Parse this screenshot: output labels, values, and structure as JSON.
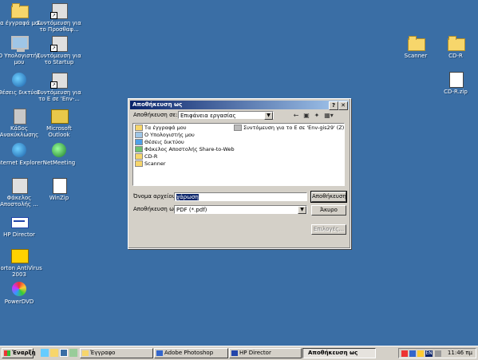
{
  "desktop": {
    "icons": [
      {
        "label": "Τα έγγραφά μου",
        "icon": "my-documents-folder-icon"
      },
      {
        "label": "Συντόμευση για το Προσθαφ...",
        "icon": "shortcut-add-remove-icon"
      },
      {
        "label": "Ο Υπολογιστής μου",
        "icon": "my-computer-icon"
      },
      {
        "label": "Συντόμευση για το Startup",
        "icon": "shortcut-startup-icon"
      },
      {
        "label": "Θέσεις δικτύου",
        "icon": "network-places-icon"
      },
      {
        "label": "Συντόμευση για το Ε σε 'Env-...",
        "icon": "shortcut-network-drive-icon"
      },
      {
        "label": "Κάδος Ανακύκλωσης",
        "icon": "recycle-bin-icon"
      },
      {
        "label": "Microsoft Outlook",
        "icon": "outlook-icon"
      },
      {
        "label": "Internet Explorer",
        "icon": "internet-explorer-icon"
      },
      {
        "label": "NetMeeting",
        "icon": "netmeeting-icon"
      },
      {
        "label": "Φάκελος Αποστολής ...",
        "icon": "send-folder-icon"
      },
      {
        "label": "WinZip",
        "icon": "winzip-icon"
      },
      {
        "label": "HP Director",
        "icon": "hp-director-icon"
      },
      {
        "label": "Norton AntiVirus 2003",
        "icon": "norton-antivirus-icon"
      },
      {
        "label": "PowerDVD",
        "icon": "powerdvd-icon"
      },
      {
        "label": "Scanner",
        "icon": "scanner-folder-icon"
      },
      {
        "label": "CD-R",
        "icon": "cdr-folder-icon"
      },
      {
        "label": "CD-R.zip",
        "icon": "zip-file-icon"
      }
    ]
  },
  "dialog": {
    "title": "Αποθήκευση ως",
    "help_btn": "?",
    "close_btn": "✕",
    "save_in_label": "Αποθήκευση σε:",
    "save_in_value": "Επιφάνεια εργασίας",
    "toolbar": [
      "back-icon",
      "up-folder-icon",
      "new-folder-icon",
      "view-menu-icon"
    ],
    "files": [
      {
        "name": "Τα έγγραφά μου"
      },
      {
        "name": "Ο Υπολογιστής μου"
      },
      {
        "name": "Θέσεις δικτύου"
      },
      {
        "name": "Φάκελος Αποστολής Share-to-Web"
      },
      {
        "name": "CD-R"
      },
      {
        "name": "Scanner"
      },
      {
        "name": "Συντόμευση για το Ε σε 'Env-gis29' (Z)"
      }
    ],
    "filename_label": "Όνομα αρχείου:",
    "filename_value": "χάρωση",
    "filetype_label": "Αποθήκευση ως:",
    "filetype_value": "PDF (*.pdf)",
    "save_button": "Αποθήκευση",
    "cancel_button": "Άκυρο",
    "options_button": "Επιλογές..."
  },
  "taskbar": {
    "start_label": "Έναρξη",
    "tasks": [
      {
        "label": "Έγγραφο",
        "active": false
      },
      {
        "label": "Adobe Photoshop",
        "active": false
      },
      {
        "label": "HP Director",
        "active": false
      },
      {
        "label": "Αποθήκευση ως",
        "active": true
      }
    ],
    "tray_lang": "EN",
    "clock": "11:46 πμ"
  }
}
